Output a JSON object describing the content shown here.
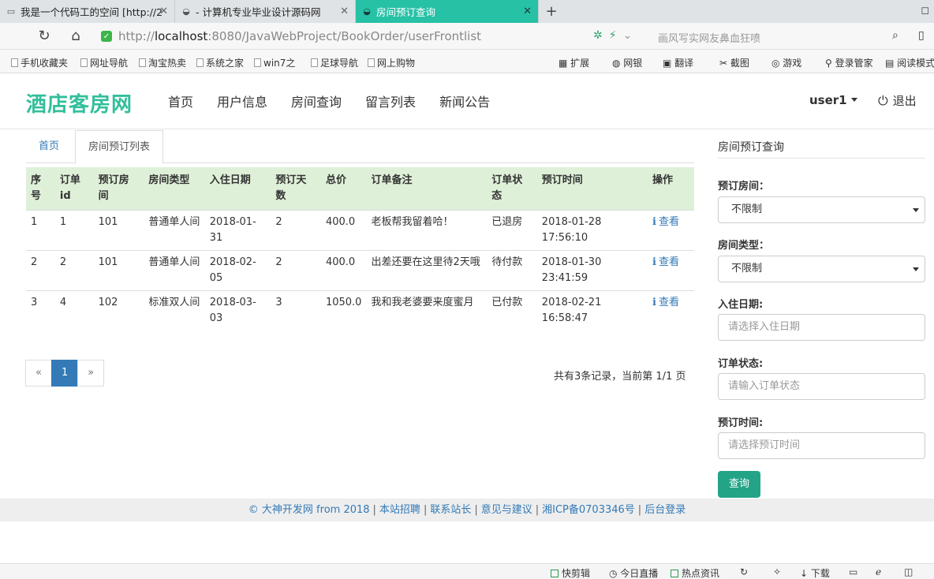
{
  "browser": {
    "tabs": [
      {
        "label": "我是一个代码工的空间 [http://2",
        "icon": "page-icon",
        "active": false
      },
      {
        "label": "- 计算机专业毕业设计源码网",
        "icon": "mask-icon",
        "active": false
      },
      {
        "label": "房间预订查询",
        "icon": "mask-icon",
        "active": true
      }
    ],
    "new_tab": "+",
    "url_prefix": "http://",
    "url_host": "localhost",
    "url_path": ":8080/JavaWebProject/BookOrder/userFrontlist",
    "search_placeholder": "画风写实网友鼻血狂喷",
    "bookmarks": [
      "手机收藏夹",
      "网址导航",
      "淘宝热卖",
      "系统之家",
      "win7之",
      "足球导航",
      "网上购物"
    ],
    "toolbar_items": [
      "扩展",
      "网银",
      "翻译",
      "截图",
      "游戏",
      "登录管家",
      "阅读模式"
    ]
  },
  "site": {
    "logo": "酒店客房网",
    "nav": [
      "首页",
      "用户信息",
      "房间查询",
      "留言列表",
      "新闻公告"
    ],
    "user": "user1",
    "logout": "退出"
  },
  "content_tabs": {
    "home": "首页",
    "list": "房间预订列表"
  },
  "table": {
    "headers": [
      "序号",
      "订单id",
      "预订房间",
      "房间类型",
      "入住日期",
      "预订天数",
      "总价",
      "订单备注",
      "订单状态",
      "预订时间",
      "操作"
    ],
    "rows": [
      {
        "no": "1",
        "order_id": "1",
        "room": "101",
        "room_type": "普通单人间",
        "checkin": "2018-01-31",
        "days": "2",
        "price": "400.0",
        "note": "老板帮我留着哈！",
        "status": "已退房",
        "order_time": "2018-01-28 17:56:10",
        "action": "查看"
      },
      {
        "no": "2",
        "order_id": "2",
        "room": "101",
        "room_type": "普通单人间",
        "checkin": "2018-02-05",
        "days": "2",
        "price": "400.0",
        "note": "出差还要在这里待2天哦",
        "status": "待付款",
        "order_time": "2018-01-30 23:41:59",
        "action": "查看"
      },
      {
        "no": "3",
        "order_id": "4",
        "room": "102",
        "room_type": "标准双人间",
        "checkin": "2018-03-03",
        "days": "3",
        "price": "1050.0",
        "note": "我和我老婆要来度蜜月",
        "status": "已付款",
        "order_time": "2018-02-21 16:58:47",
        "action": "查看"
      }
    ]
  },
  "pagination": {
    "prev": "«",
    "current": "1",
    "next": "»",
    "summary": "共有3条记录，当前第 1/1 页"
  },
  "search_panel": {
    "title": "房间预订查询",
    "room_label": "预订房间：",
    "room_value": "不限制",
    "type_label": "房间类型：",
    "type_value": "不限制",
    "checkin_label": "入住日期:",
    "checkin_placeholder": "请选择入住日期",
    "status_label": "订单状态:",
    "status_placeholder": "请输入订单状态",
    "time_label": "预订时间:",
    "time_placeholder": "请选择预订时间",
    "submit": "查询"
  },
  "footer": [
    "© 大神开发网 from 2018",
    "本站招聘",
    "联系站长",
    "意见与建议",
    "湘ICP备0703346号",
    "后台登录"
  ],
  "statusbar": [
    "快剪辑",
    "今日直播",
    "热点资讯",
    "下载"
  ],
  "colors": {
    "brand": "#32bf9b",
    "link": "#337ab7",
    "table_head": "#dff0d8",
    "button": "#23a487",
    "active_tab": "#27c1a6"
  }
}
